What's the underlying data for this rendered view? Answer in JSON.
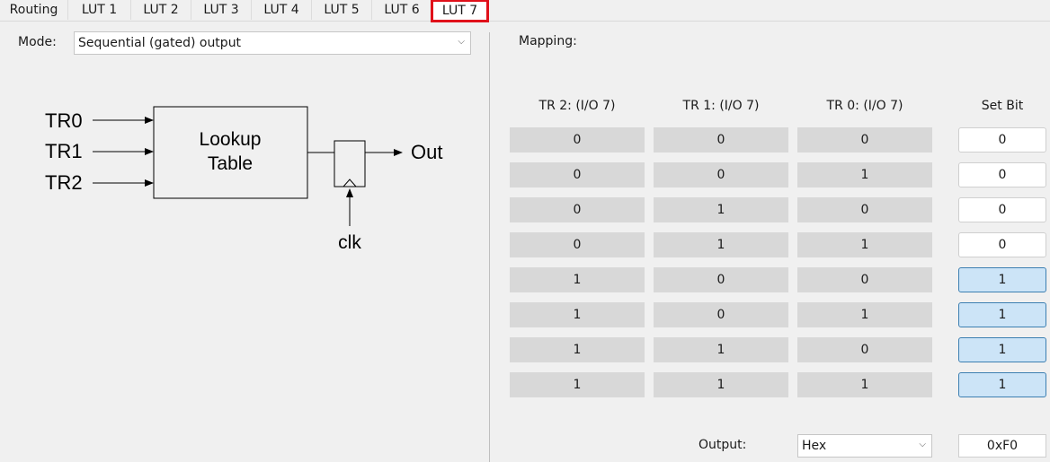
{
  "tabs": [
    "Routing",
    "LUT 1",
    "LUT 2",
    "LUT 3",
    "LUT 4",
    "LUT 5",
    "LUT 6",
    "LUT 7"
  ],
  "active_tab": "LUT 7",
  "mode": {
    "label": "Mode:",
    "value": "Sequential (gated) output"
  },
  "diagram": {
    "inputs": [
      "TR0",
      "TR1",
      "TR2"
    ],
    "block_line1": "Lookup",
    "block_line2": "Table",
    "output": "Out",
    "clock": "clk"
  },
  "mapping": {
    "label": "Mapping:",
    "headers": [
      "TR 2:  (I/O 7)",
      "TR 1:  (I/O 7)",
      "TR 0:  (I/O 7)",
      "Set Bit"
    ],
    "rows": [
      {
        "tr2": "0",
        "tr1": "0",
        "tr0": "0",
        "bit": "0"
      },
      {
        "tr2": "0",
        "tr1": "0",
        "tr0": "1",
        "bit": "0"
      },
      {
        "tr2": "0",
        "tr1": "1",
        "tr0": "0",
        "bit": "0"
      },
      {
        "tr2": "0",
        "tr1": "1",
        "tr0": "1",
        "bit": "0"
      },
      {
        "tr2": "1",
        "tr1": "0",
        "tr0": "0",
        "bit": "1"
      },
      {
        "tr2": "1",
        "tr1": "0",
        "tr0": "1",
        "bit": "1"
      },
      {
        "tr2": "1",
        "tr1": "1",
        "tr0": "0",
        "bit": "1"
      },
      {
        "tr2": "1",
        "tr1": "1",
        "tr0": "1",
        "bit": "1"
      }
    ]
  },
  "output": {
    "label": "Output:",
    "format": "Hex",
    "value": "0xF0"
  },
  "colors": {
    "active_tab_border": "#e0101a",
    "bit_on_bg": "#cce4f7",
    "bit_on_border": "#3c7fb1",
    "cell_bg": "#d8d8d8"
  }
}
